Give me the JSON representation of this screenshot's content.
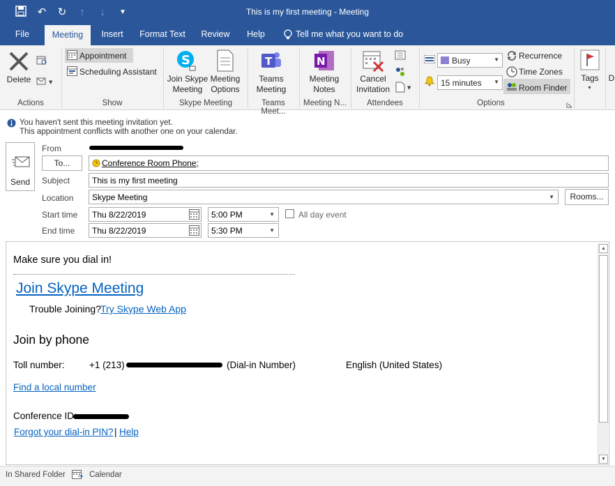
{
  "window": {
    "title": "This is my first meeting  -  Meeting"
  },
  "tabs": [
    {
      "label": "File"
    },
    {
      "label": "Meeting"
    },
    {
      "label": "Insert"
    },
    {
      "label": "Format Text"
    },
    {
      "label": "Review"
    },
    {
      "label": "Help"
    },
    {
      "label": "Tell me what you want to do"
    }
  ],
  "ribbon": {
    "actions": {
      "group": "Actions",
      "delete": "Delete"
    },
    "show": {
      "group": "Show",
      "appointment": "Appointment",
      "scheduling": "Scheduling Assistant"
    },
    "skype": {
      "group": "Skype Meeting",
      "join1": "Join Skype",
      "join2": "Meeting",
      "options1": "Meeting",
      "options2": "Options"
    },
    "teams": {
      "group": "Teams Meet...",
      "label1": "Teams",
      "label2": "Meeting"
    },
    "notes": {
      "group": "Meeting N...",
      "label1": "Meeting",
      "label2": "Notes"
    },
    "attendees": {
      "group": "Attendees",
      "cancel1": "Cancel",
      "cancel2": "Invitation"
    },
    "options": {
      "group": "Options",
      "show_as": "Busy",
      "reminder": "15 minutes",
      "recurrence": "Recurrence",
      "time_zones": "Time Zones",
      "room_finder": "Room Finder"
    },
    "tags": {
      "label": "Tags"
    },
    "cut_off": "D"
  },
  "infobar": {
    "line1": "You haven't sent this meeting invitation yet.",
    "line2": "This appointment conflicts with another one on your calendar."
  },
  "form": {
    "send": "Send",
    "from_label": "From",
    "to_button": "To...",
    "to_value": "Conference Room Phone;",
    "subject_label": "Subject",
    "subject_value": "This is my first meeting",
    "location_label": "Location",
    "location_value": "Skype Meeting",
    "rooms_button": "Rooms...",
    "start_label": "Start time",
    "start_date": "Thu 8/22/2019",
    "start_time": "5:00 PM",
    "all_day": "All day event",
    "end_label": "End time",
    "end_date": "Thu 8/22/2019",
    "end_time": "5:30 PM"
  },
  "body": {
    "intro": "Make sure you dial in!",
    "join_link": "Join Skype Meeting",
    "trouble": "Trouble Joining?",
    "web_app_link": "Try Skype Web App",
    "join_phone": "Join by phone",
    "toll_label": "Toll number:",
    "toll_prefix": "+1 (213)",
    "dialin_suffix": "(Dial-in Number)",
    "language": "English (United States)",
    "local_link": "Find a local number",
    "conf_label": "Conference ID:",
    "pin_link": "Forgot your dial-in PIN?",
    "pipe": "|",
    "help_link": "Help"
  },
  "status": {
    "folder": "In Shared Folder",
    "calendar": "Calendar"
  },
  "colors": {
    "accent": "#2b579a",
    "link": "#0563c1",
    "info": "#2b579a"
  }
}
